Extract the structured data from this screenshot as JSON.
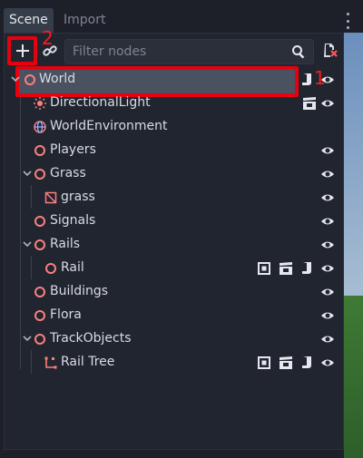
{
  "tabs": [
    {
      "label": "Scene",
      "active": true
    },
    {
      "label": "Import",
      "active": false
    }
  ],
  "toolbar": {
    "add_icon": "plus-icon",
    "link_icon": "link-icon",
    "filter_placeholder": "Filter nodes",
    "filter_value": "",
    "search_icon": "search-icon",
    "remote_icon": "remote-scene-icon"
  },
  "annotations": {
    "add_marker": "2",
    "world_marker": "1",
    "color": "#e8000f"
  },
  "tree": [
    {
      "label": "World",
      "icon": "node3d-icon",
      "depth": 0,
      "collapsed": false,
      "selected": true,
      "extras": [
        "script-icon"
      ],
      "visible": true
    },
    {
      "label": "DirectionalLight",
      "icon": "light-icon",
      "depth": 1,
      "extras": [
        "clapper-icon"
      ],
      "visible": true
    },
    {
      "label": "WorldEnvironment",
      "icon": "globe-icon",
      "depth": 1,
      "extras": [],
      "visible": null
    },
    {
      "label": "Players",
      "icon": "node3d-icon",
      "depth": 1,
      "extras": [],
      "visible": true
    },
    {
      "label": "Grass",
      "icon": "node3d-icon",
      "depth": 1,
      "collapsed": false,
      "extras": [],
      "visible": true
    },
    {
      "label": "grass",
      "icon": "mesh-icon",
      "depth": 2,
      "extras": [],
      "visible": true
    },
    {
      "label": "Signals",
      "icon": "node3d-icon",
      "depth": 1,
      "extras": [],
      "visible": true
    },
    {
      "label": "Rails",
      "icon": "node3d-icon",
      "depth": 1,
      "collapsed": false,
      "extras": [],
      "visible": true
    },
    {
      "label": "Rail",
      "icon": "node3d-icon",
      "depth": 2,
      "extras": [
        "instance-icon",
        "clapper-icon",
        "script-icon"
      ],
      "visible": true
    },
    {
      "label": "Buildings",
      "icon": "node3d-icon",
      "depth": 1,
      "extras": [],
      "visible": true
    },
    {
      "label": "Flora",
      "icon": "node3d-icon",
      "depth": 1,
      "extras": [],
      "visible": true
    },
    {
      "label": "TrackObjects",
      "icon": "node3d-icon",
      "depth": 1,
      "collapsed": false,
      "extras": [],
      "visible": true
    },
    {
      "label": "Rail Tree",
      "icon": "path-icon",
      "depth": 2,
      "extras": [
        "instance-icon",
        "clapper-icon",
        "script-icon"
      ],
      "visible": true
    }
  ],
  "colors": {
    "node_icon": "#fc7f7f",
    "accent_red": "#e8000f",
    "selected_row": "#4a5262"
  }
}
